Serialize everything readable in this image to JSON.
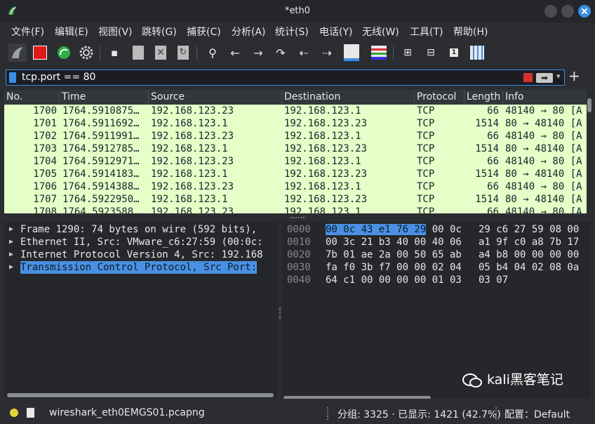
{
  "window": {
    "title": "*eth0"
  },
  "menu": [
    "文件(F)",
    "编辑(E)",
    "视图(V)",
    "跳转(G)",
    "捕获(C)",
    "分析(A)",
    "统计(S)",
    "电话(Y)",
    "无线(W)",
    "工具(T)",
    "帮助(H)"
  ],
  "toolbar": {
    "icons": [
      "shark-fin-icon",
      "stop-icon",
      "restart-icon",
      "options-gear-icon",
      "open-file-icon",
      "save-file-icon",
      "close-file-icon",
      "reload-file-icon",
      "search-icon",
      "back-icon",
      "forward-icon",
      "goto-packet-icon",
      "first-packet-icon",
      "last-packet-icon",
      "autoscroll-icon",
      "colorize-icon",
      "zoom-in-icon",
      "zoom-out-icon",
      "normal-size-icon",
      "resize-columns-icon"
    ]
  },
  "filter": {
    "value": "tcp.port == 80"
  },
  "packet_list": {
    "columns": [
      "No.",
      "Time",
      "Source",
      "Destination",
      "Protocol",
      "Length",
      "Info"
    ],
    "rows": [
      {
        "no": "1700",
        "time": "1764.5910875…",
        "src": "192.168.123.23",
        "dst": "192.168.123.1",
        "proto": "TCP",
        "len": "66",
        "info": "48140 → 80 [A"
      },
      {
        "no": "1701",
        "time": "1764.5911692…",
        "src": "192.168.123.1",
        "dst": "192.168.123.23",
        "proto": "TCP",
        "len": "1514",
        "info": "80 → 48140 [A"
      },
      {
        "no": "1702",
        "time": "1764.5911991…",
        "src": "192.168.123.23",
        "dst": "192.168.123.1",
        "proto": "TCP",
        "len": "66",
        "info": "48140 → 80 [A"
      },
      {
        "no": "1703",
        "time": "1764.5912785…",
        "src": "192.168.123.1",
        "dst": "192.168.123.23",
        "proto": "TCP",
        "len": "1514",
        "info": "80 → 48140 [A"
      },
      {
        "no": "1704",
        "time": "1764.5912971…",
        "src": "192.168.123.23",
        "dst": "192.168.123.1",
        "proto": "TCP",
        "len": "66",
        "info": "48140 → 80 [A"
      },
      {
        "no": "1705",
        "time": "1764.5914183…",
        "src": "192.168.123.1",
        "dst": "192.168.123.23",
        "proto": "TCP",
        "len": "1514",
        "info": "80 → 48140 [A"
      },
      {
        "no": "1706",
        "time": "1764.5914388…",
        "src": "192.168.123.23",
        "dst": "192.168.123.1",
        "proto": "TCP",
        "len": "66",
        "info": "48140 → 80 [A"
      },
      {
        "no": "1707",
        "time": "1764.5922950…",
        "src": "192.168.123.1",
        "dst": "192.168.123.23",
        "proto": "TCP",
        "len": "1514",
        "info": "80 → 48140 [A"
      },
      {
        "no": "1708",
        "time": "1764.5923588…",
        "src": "192.168.123.23",
        "dst": "192.168.123.1",
        "proto": "TCP",
        "len": "66",
        "info": "48140 → 80 [A"
      }
    ]
  },
  "details": [
    "Frame 1290: 74 bytes on wire (592 bits), ",
    "Ethernet II, Src: VMware_c6:27:59 (00:0c:",
    "Internet Protocol Version 4, Src: 192.168",
    "Transmission Control Protocol, Src Port: "
  ],
  "hex": [
    {
      "off": "0000",
      "a": "00 0c 43 e1 76 29 00 0c",
      "b": "29 c6 27 59 08 00"
    },
    {
      "off": "0010",
      "a": "00 3c 21 b3 40 00 40 06",
      "b": "a1 9f c0 a8 7b 17"
    },
    {
      "off": "0020",
      "a": "7b 01 ae 2a 00 50 65 ab",
      "b": "a4 b8 00 00 00 00"
    },
    {
      "off": "0030",
      "a": "fa f0 3b f7 00 00 02 04",
      "b": "05 b4 04 02 08 0a"
    },
    {
      "off": "0040",
      "a": "64 c1 00 00 00 00 01 03",
      "b": "03 07"
    }
  ],
  "hex_highlight": "00 0c 43 e1 76 29",
  "status": {
    "file": "wireshark_eth0EMGS01.pcapng",
    "counts": "分组: 3325 · 已显示: 1421 (42.7%)",
    "profile": "配置：Default"
  },
  "watermark": "kali黑客笔记",
  "colors": {
    "packet_bg": "#e4ffc7",
    "accent": "#4a90e2",
    "window": "#2b2d31"
  }
}
